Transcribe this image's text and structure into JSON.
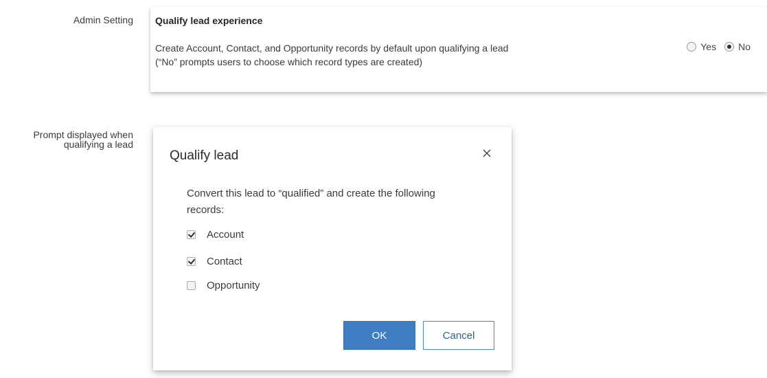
{
  "labels": {
    "admin_setting": "Admin Setting",
    "prompt_line1": "Prompt displayed when",
    "prompt_line2": "qualifying a lead"
  },
  "admin_card": {
    "title": "Qualify lead experience",
    "description_line1": "Create Account, Contact, and Opportunity records by default upon qualifying a lead",
    "description_line2": "(“No” prompts users to choose which record types are created)",
    "options": [
      {
        "label": "Yes",
        "selected": false
      },
      {
        "label": "No",
        "selected": true
      }
    ]
  },
  "dialog": {
    "title": "Qualify lead",
    "close_icon": "close-icon",
    "message_line1": "Convert this lead to “qualified” and create the following",
    "message_line2": "records:",
    "checkboxes": [
      {
        "label": "Account",
        "checked": true
      },
      {
        "label": "Contact",
        "checked": true
      },
      {
        "label": "Opportunity",
        "checked": false
      }
    ],
    "ok_label": "OK",
    "cancel_label": "Cancel"
  },
  "colors": {
    "primary_button": "#3f7ec3",
    "cancel_text": "#2c5f99"
  }
}
